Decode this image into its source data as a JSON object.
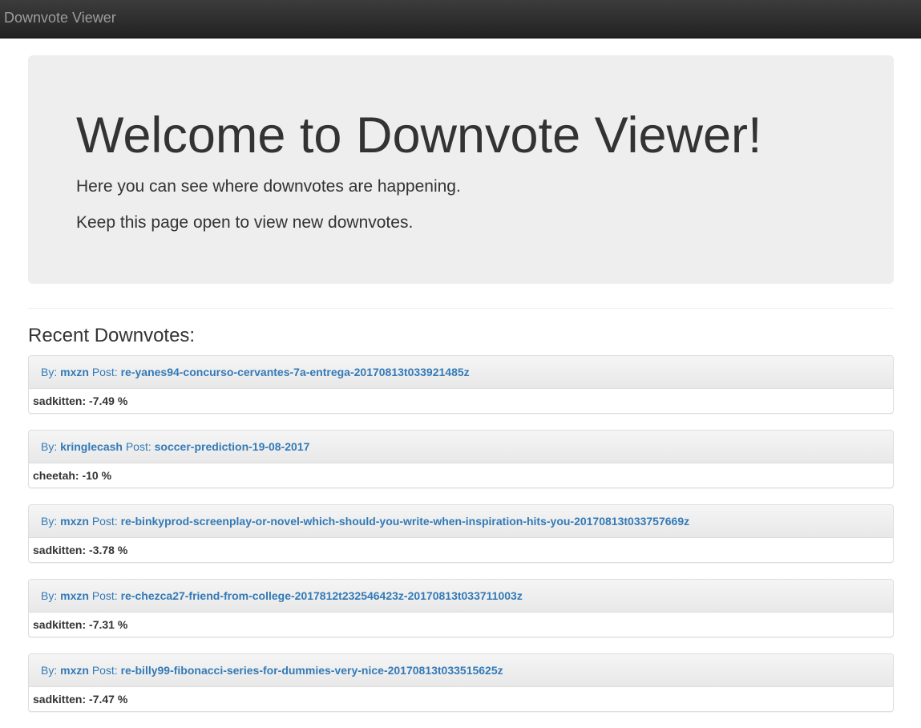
{
  "navbar": {
    "brand": "Downvote Viewer"
  },
  "jumbotron": {
    "title": "Welcome to Downvote Viewer!",
    "lead1": "Here you can see where downvotes are happening.",
    "lead2": "Keep this page open to view new downvotes."
  },
  "recent": {
    "title": "Recent Downvotes:",
    "by_label": "By:",
    "post_label": "Post:",
    "items": [
      {
        "author": "mxzn",
        "post": "re-yanes94-concurso-cervantes-7a-entrega-20170813t033921485z",
        "voter": "sadkitten",
        "percent": "-7.49 %"
      },
      {
        "author": "kringlecash",
        "post": "soccer-prediction-19-08-2017",
        "voter": "cheetah",
        "percent": "-10 %"
      },
      {
        "author": "mxzn",
        "post": "re-binkyprod-screenplay-or-novel-which-should-you-write-when-inspiration-hits-you-20170813t033757669z",
        "voter": "sadkitten",
        "percent": "-3.78 %"
      },
      {
        "author": "mxzn",
        "post": "re-chezca27-friend-from-college-2017812t232546423z-20170813t033711003z",
        "voter": "sadkitten",
        "percent": "-7.31 %"
      },
      {
        "author": "mxzn",
        "post": "re-billy99-fibonacci-series-for-dummies-very-nice-20170813t033515625z",
        "voter": "sadkitten",
        "percent": "-7.47 %"
      }
    ]
  }
}
